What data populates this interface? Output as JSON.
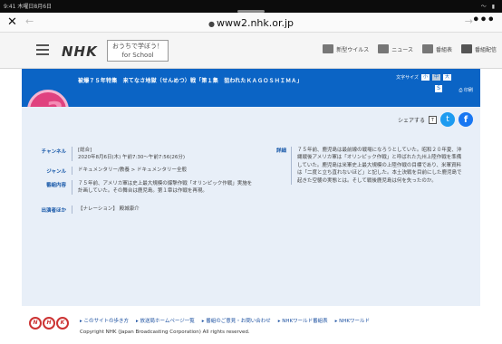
{
  "status_bar": {
    "time": "9:41 木曜日8月6日",
    "right": "〜 ▮"
  },
  "browser": {
    "close_label": "✕",
    "back_label": "←",
    "url": "www2.nhk.or.jp",
    "forward_label": "→",
    "more_label": "•••"
  },
  "header": {
    "logo": "NHK",
    "school_line1": "おうちで学ぼう！",
    "school_line2": "for School",
    "links": [
      {
        "label": "新型ウイルス"
      },
      {
        "label": "ニュース"
      },
      {
        "label": "番組表"
      },
      {
        "label": "番組配信"
      }
    ]
  },
  "banner": {
    "title": "被爆７５年特集　来てなさ地獄（せんめつ）戦「第１集　狙われたＫＡＧＯＳＨＩＭＡ」",
    "fontsize_label": "文字サイズ",
    "fontsize_options": [
      "小",
      "中",
      "大"
    ],
    "s_label": "S",
    "print_label": "印刷"
  },
  "channel_badge": {
    "label": "総合",
    "number": "3"
  },
  "share": {
    "label": "シェアする",
    "box": "T",
    "twitter": "t",
    "facebook": "f"
  },
  "info": {
    "rows": [
      {
        "key": "チャンネル",
        "value": "[総合]\n2020年8月6日(木) 午前7:30〜午前7:56(26分)"
      },
      {
        "key": "ジャンル",
        "value": "ドキュメンタリー/教養 > ドキュメンタリー全般"
      },
      {
        "key": "番組内容",
        "value": "７５年前、アメリカ軍は史上最大規模の爆撃作戦「オリンピック作戦」実施を計画していた。その舞台は鹿児島。第１章は作戦を再現。"
      },
      {
        "key": "出演者ほか",
        "value": "【ナレーション】 殿城康介"
      }
    ]
  },
  "detail": {
    "key": "詳細",
    "value": "７５年前、鹿児島は最前線の戦場になろうとしていた。昭和２０年夏、沖縄戦後アメリカ軍は「オリンピック作戦」と呼ばれた九州上陸作戦を準備していた。鹿児島は米軍史上最大規模の上陸作戦の目標であり、米軍資料は「二度と立ち直れないほど」と記した。本土決戦を目前にした鹿児島で起きた空襲の実態とは。そして戦後鹿児島は何を失ったのか。"
  },
  "footer": {
    "logo_letters": [
      "N",
      "H",
      "K"
    ],
    "links": [
      "▸ このサイトの歩き方",
      "▸ 放送局ホームページ一覧",
      "▸ 番組のご意見・お問い合わせ",
      "▸ NHKワールド番組表",
      "▸ NHKワールド"
    ],
    "copyright": "Copyright NHK (Japan Broadcasting Corporation) All rights reserved."
  }
}
